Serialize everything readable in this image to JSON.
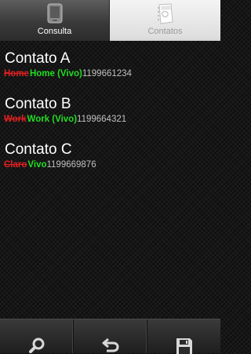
{
  "tabs": [
    {
      "label": "Consulta",
      "icon": "phone-icon",
      "selected": true
    },
    {
      "label": "Contatos",
      "icon": "contacts-book-icon",
      "selected": false
    }
  ],
  "contacts": [
    {
      "name": "Contato A",
      "old_label": "Home",
      "new_label": "Home (Vivo)",
      "number": "1199661234"
    },
    {
      "name": "Contato B",
      "old_label": "Work",
      "new_label": "Work (Vivo)",
      "number": "1199664321"
    },
    {
      "name": "Contato C",
      "old_label": "Claro",
      "new_label": "Vivo",
      "number": "1199669876"
    }
  ],
  "actions": [
    {
      "icon": "search-icon"
    },
    {
      "icon": "back-arrow-icon"
    },
    {
      "icon": "save-icon"
    }
  ],
  "colors": {
    "old_label": "#e02020",
    "new_label": "#22dd22",
    "text": "#ffffff"
  }
}
